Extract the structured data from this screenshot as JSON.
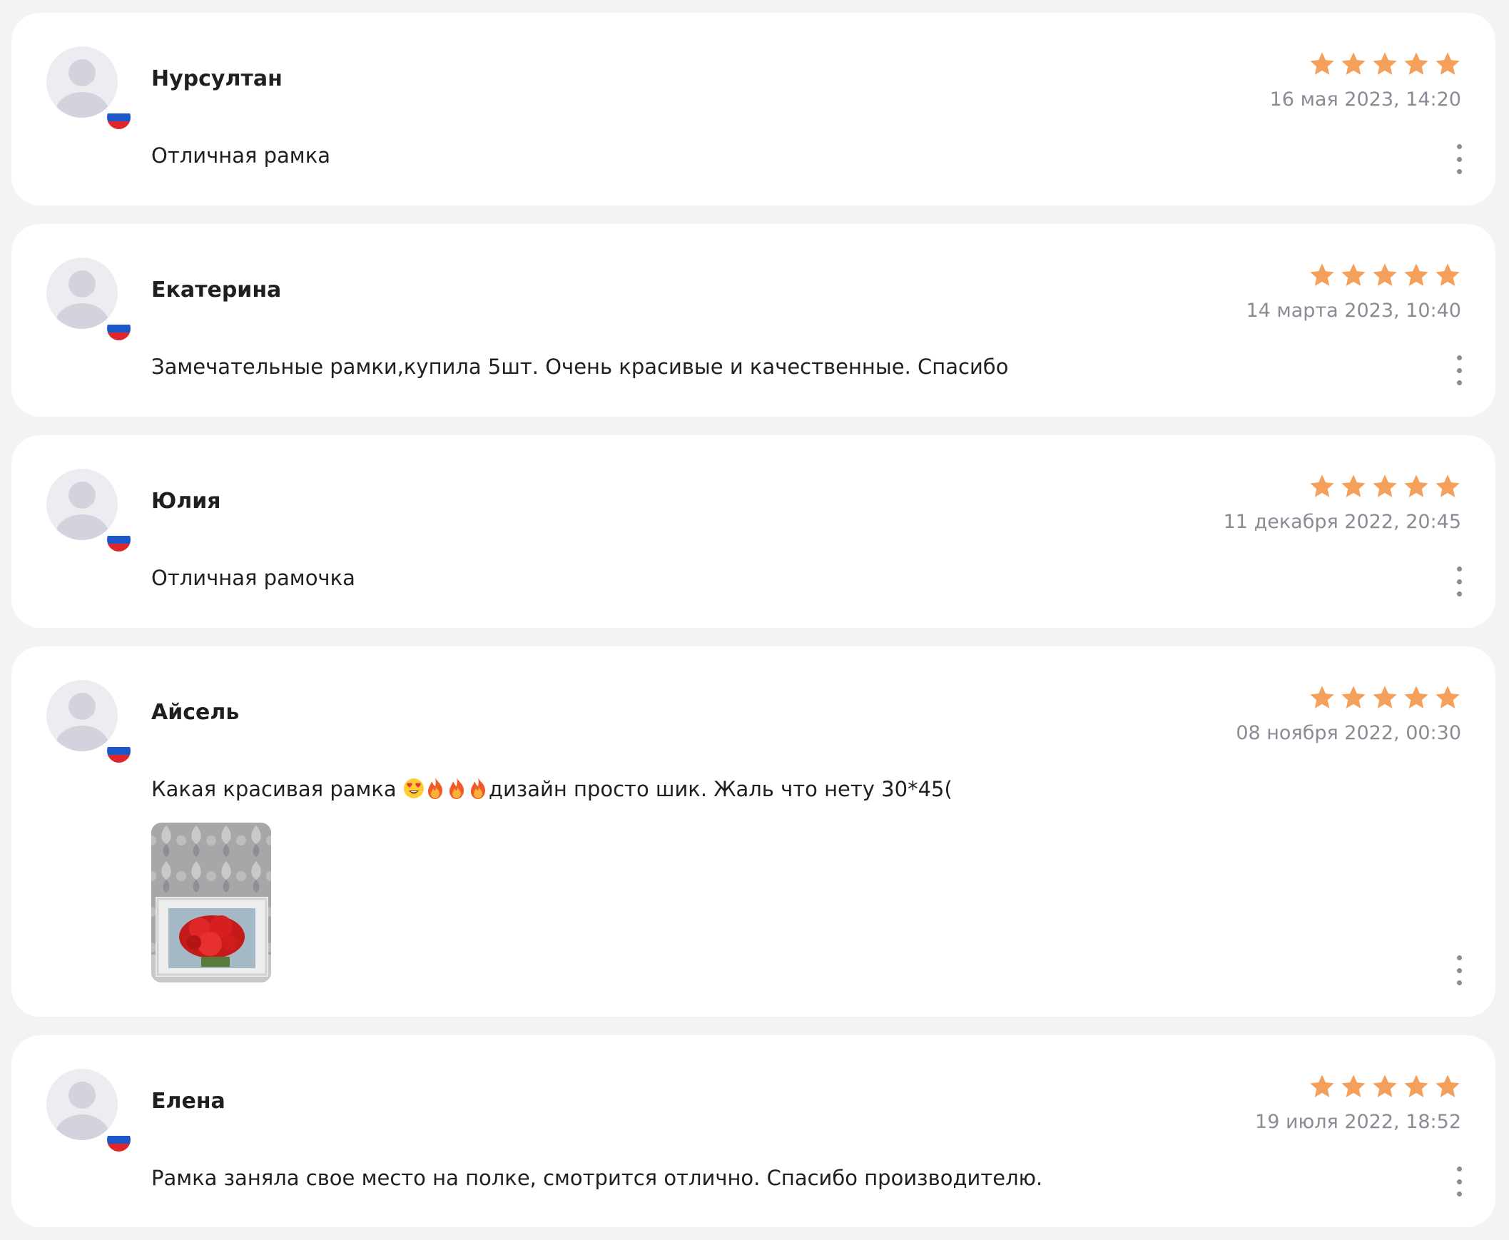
{
  "accent": {
    "star": "#f5a05a",
    "flag": [
      "#ffffff",
      "#1c57c9",
      "#e0262a"
    ]
  },
  "reviews": [
    {
      "author": "Нурсултан",
      "rating": 5,
      "date": "16 мая 2023, 14:20",
      "text": "Отличная рамка",
      "flag": "russia-flag",
      "has_photo": false
    },
    {
      "author": "Екатерина",
      "rating": 5,
      "date": "14 марта 2023, 10:40",
      "text": "Замечательные рамки,купила 5шт. Очень красивые и качественные. Спасибо",
      "flag": "russia-flag",
      "has_photo": false
    },
    {
      "author": "Юлия",
      "rating": 5,
      "date": "11 декабря 2022, 20:45",
      "text": "Отличная рамочка",
      "flag": "russia-flag",
      "has_photo": false
    },
    {
      "author": "Айсель",
      "rating": 5,
      "date": "08 ноября 2022, 00:30",
      "text_before": "Какая красивая рамка ",
      "emojis": [
        "heart-eyes-emoji",
        "fire-emoji",
        "fire-emoji",
        "fire-emoji"
      ],
      "text_after": "дизайн просто шик. Жаль что нету 30*45(",
      "flag": "russia-flag",
      "has_photo": true,
      "photo": "review-photo-red-roses-heart-in-white-frame"
    },
    {
      "author": "Елена",
      "rating": 5,
      "date": "19 июля 2022, 18:52",
      "text": "Рамка заняла свое место на полке, смотрится отлично. Спасибо производителю.",
      "flag": "russia-flag",
      "has_photo": false
    }
  ]
}
